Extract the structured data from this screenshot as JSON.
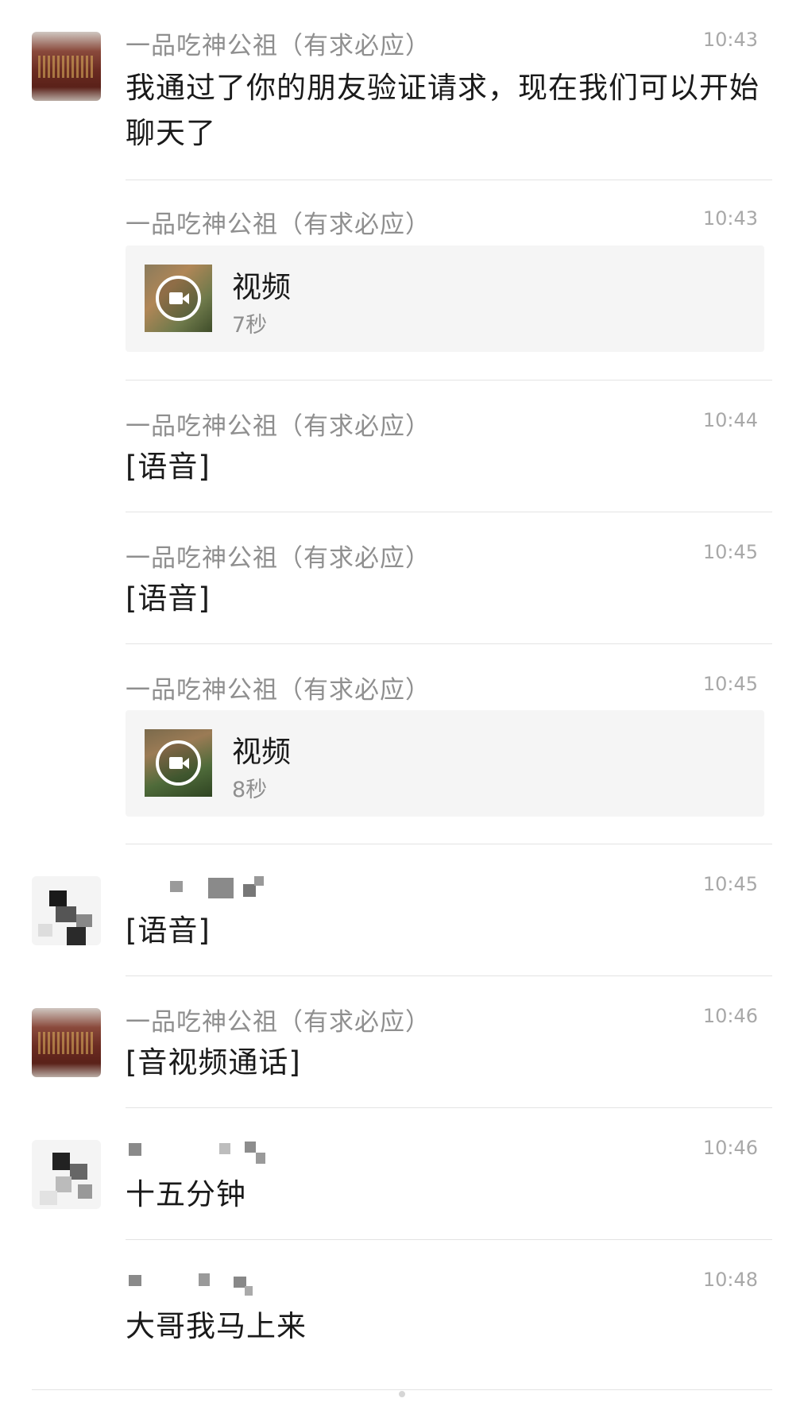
{
  "messages": [
    {
      "sender": "一品吃神公祖（有求必应）",
      "time": "10:43",
      "text": "我通过了你的朋友验证请求，现在我们可以开始聊天了"
    },
    {
      "sender": "一品吃神公祖（有求必应）",
      "time": "10:43",
      "video_title": "视频",
      "video_duration": "7秒"
    },
    {
      "sender": "一品吃神公祖（有求必应）",
      "time": "10:44",
      "text": "[语音]"
    },
    {
      "sender": "一品吃神公祖（有求必应）",
      "time": "10:45",
      "text": "[语音]"
    },
    {
      "sender": "一品吃神公祖（有求必应）",
      "time": "10:45",
      "video_title": "视频",
      "video_duration": "8秒"
    },
    {
      "sender": "",
      "time": "10:45",
      "text": "[语音]"
    },
    {
      "sender": "一品吃神公祖（有求必应）",
      "time": "10:46",
      "text": "[音视频通话]"
    },
    {
      "sender": "",
      "time": "10:46",
      "text": "十五分钟"
    },
    {
      "sender": "",
      "time": "10:48",
      "text": "大哥我马上来"
    }
  ],
  "icons": {
    "video": "video-camera-play-icon"
  },
  "colors": {
    "sender": "#8f8f8f",
    "time": "#a8a8a8",
    "divider": "#e3e3e3",
    "card": "#f5f5f5"
  }
}
